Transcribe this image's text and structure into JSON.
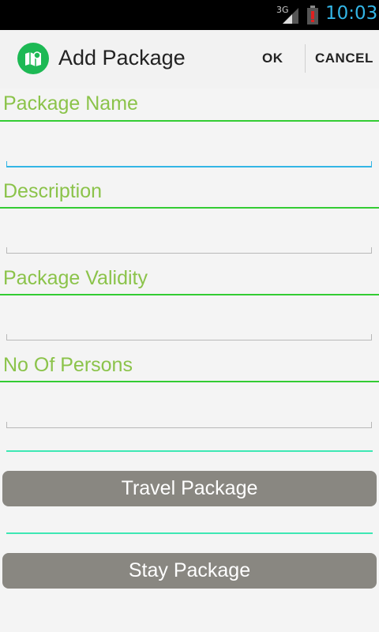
{
  "status_bar": {
    "network_type": "3G",
    "time": "10:03",
    "time_color": "#33b5e5"
  },
  "action_bar": {
    "title": "Add Package",
    "app_icon": "map-icon",
    "ok_label": "OK",
    "cancel_label": "CANCEL"
  },
  "form": {
    "fields": [
      {
        "label": "Package Name",
        "value": ""
      },
      {
        "label": "Description",
        "value": ""
      },
      {
        "label": "Package Validity",
        "value": ""
      },
      {
        "label": "No Of Persons",
        "value": ""
      }
    ],
    "label_color": "#8bc34a",
    "focused_field": "Package Name"
  },
  "buttons": {
    "travel_package": "Travel Package",
    "stay_package": "Stay Package"
  }
}
